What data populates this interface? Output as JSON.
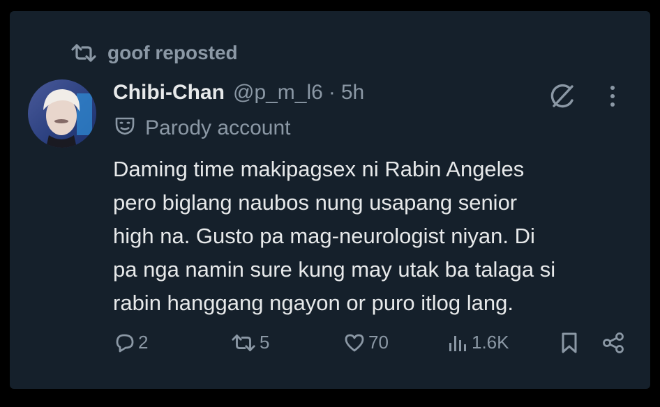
{
  "repost": {
    "icon": "repost-icon",
    "text": "goof reposted"
  },
  "tweet": {
    "author": {
      "name": "Chibi-Chan",
      "handle": "@p_m_l6",
      "separator": "·",
      "time": "5h",
      "avatar": "avatar-photo"
    },
    "parody_label": "Parody account",
    "body": "Daming time makipagsex ni Rabin Angeles\npero biglang naubos nung usapang senior\nhigh na. Gusto pa mag-neurologist niyan. Di\npa nga namin sure kung may utak ba talaga si\nrabin hanggang ngayon or puro itlog lang."
  },
  "actions": {
    "replies": "2",
    "reposts": "5",
    "likes": "70",
    "views": "1.6K"
  },
  "colors": {
    "background": "#15202b",
    "primary_text": "#e7e9ea",
    "secondary_text": "#8b98a5"
  }
}
